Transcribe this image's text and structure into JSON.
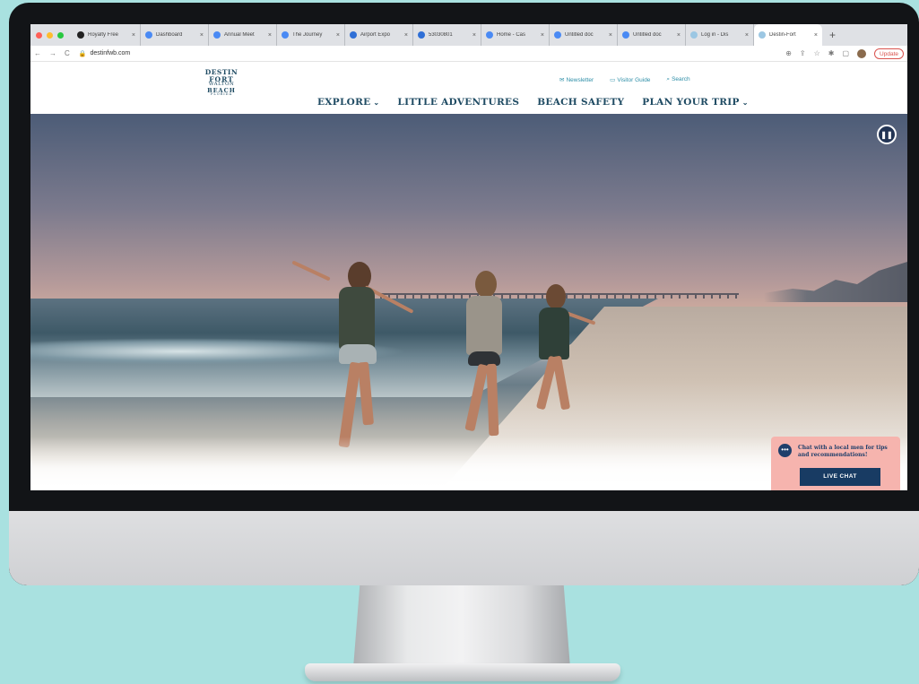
{
  "browser": {
    "tabs": [
      {
        "title": "Royalty Free",
        "favicon_color": "#222222"
      },
      {
        "title": "Dashboard",
        "favicon_color": "#4a8af4"
      },
      {
        "title": "Annual Meet",
        "favicon_color": "#4a8af4"
      },
      {
        "title": "The Journey",
        "favicon_color": "#4a8af4"
      },
      {
        "title": "Airport Expo",
        "favicon_color": "#2f6fd6"
      },
      {
        "title": "53030801",
        "favicon_color": "#2f6fd6"
      },
      {
        "title": "Home - Cas",
        "favicon_color": "#4a8af4"
      },
      {
        "title": "Untitled doc",
        "favicon_color": "#4a8af4"
      },
      {
        "title": "Untitled doc",
        "favicon_color": "#4a8af4"
      },
      {
        "title": "Log in - Dis",
        "favicon_color": "#9cc7e3"
      },
      {
        "title": "Destin-Fort",
        "favicon_color": "#9cc7e3",
        "active": true
      }
    ],
    "new_tab": "+",
    "url": "destinfwb.com",
    "update_label": "Update"
  },
  "site": {
    "logo": {
      "line1": "DESTIN",
      "line2": "FORT",
      "line3": "WALTON",
      "line4": "BEACH",
      "line5": "FLORIDA"
    },
    "utility_links": [
      "Newsletter",
      "Visitor Guide",
      "Search"
    ],
    "nav": [
      {
        "label": "EXPLORE",
        "dropdown": true
      },
      {
        "label": "LITTLE ADVENTURES",
        "dropdown": false
      },
      {
        "label": "BEACH SAFETY",
        "dropdown": false
      },
      {
        "label": "PLAN YOUR TRIP",
        "dropdown": true
      }
    ]
  },
  "chat": {
    "message": "Chat with a local men for tips and recommendations!",
    "button_label": "LIVE CHAT"
  },
  "colors": {
    "brand_navy": "#1f4b63",
    "link_teal": "#2f8fa8",
    "chat_bg": "#f6b4ae",
    "chat_button": "#183b63",
    "background": "#a9e1e0"
  }
}
